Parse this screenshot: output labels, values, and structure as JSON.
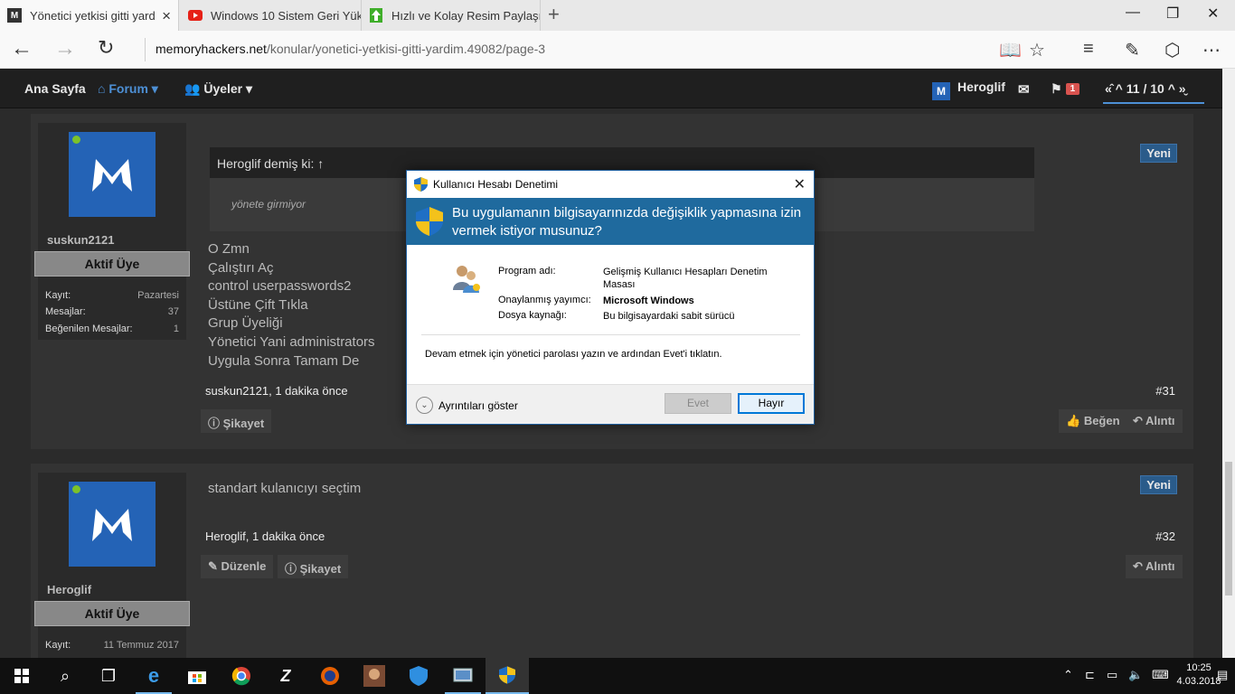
{
  "browser": {
    "tabs": [
      {
        "title": "Yönetici yetkisi gitti yard",
        "favicon": "M",
        "favicon_color": "#333333",
        "active": true
      },
      {
        "title": "Windows 10 Sistem Geri Yük",
        "favicon": "youtube-icon",
        "favicon_color": "#e62117",
        "active": false
      },
      {
        "title": "Hızlı ve Kolay Resim Paylaşır",
        "favicon": "upload-arrow-icon",
        "favicon_color": "#3fae2a",
        "active": false
      }
    ],
    "url_host": "memoryhackers.net",
    "url_path": "/konular/yonetici-yetkisi-gitti-yardim.49082/page-3"
  },
  "forum_nav": {
    "home": "Ana Sayfa",
    "forum": "Forum",
    "members": "Üyeler",
    "username": "Heroglif",
    "alerts_count": "1",
    "pager": "11 / 10"
  },
  "posts": [
    {
      "username": "suskun2121",
      "rank": "Aktif Üye",
      "stats": [
        {
          "label": "Kayıt:",
          "value": "Pazartesi"
        },
        {
          "label": "Mesajlar:",
          "value": "37"
        },
        {
          "label": "Beğenilen Mesajlar:",
          "value": "1"
        }
      ],
      "quote_header": "Heroglif demiş ki: ↑",
      "quote_body": "yönete girmiyor",
      "lines": [
        "O Zmn",
        "Çalıştırı Aç",
        "control userpasswords2",
        "Üstüne Çift Tıkla",
        "Grup Üyeliği",
        "Yönetici Yani administrators",
        "Uygula Sonra Tamam De"
      ],
      "meta": "suskun2121, 1 dakika önce",
      "number": "#31",
      "badge": "Yeni",
      "report": "Şikayet",
      "like": "Beğen",
      "reply": "Alıntı"
    },
    {
      "username": "Heroglif",
      "rank": "Aktif Üye",
      "stats": [
        {
          "label": "Kayıt:",
          "value": "11 Temmuz 2017"
        }
      ],
      "message": "standart kulanıcıyı seçtim",
      "meta": "Heroglif, 1 dakika önce",
      "number": "#32",
      "badge": "Yeni",
      "edit": "Düzenle",
      "report": "Şikayet",
      "reply": "Alıntı"
    }
  ],
  "uac": {
    "title": "Kullanıcı Hesabı Denetimi",
    "question": "Bu uygulamanın bilgisayarınızda değişiklik yapmasına izin vermek istiyor musunuz?",
    "program_label": "Program adı:",
    "program_value": "Gelişmiş Kullanıcı Hesapları Denetim Masası",
    "publisher_label": "Onaylanmış yayımcı:",
    "publisher_value": "Microsoft Windows",
    "source_label": "Dosya kaynağı:",
    "source_value": "Bu bilgisayardaki sabit sürücü",
    "instruction": "Devam etmek için yönetici parolası yazın ve ardından Evet'i tıklatın.",
    "details": "Ayrıntıları göster",
    "yes": "Evet",
    "no": "Hayır",
    "header_color": "#1f6a9e"
  },
  "taskbar": {
    "time": "10:25",
    "date": "4.03.2018"
  }
}
